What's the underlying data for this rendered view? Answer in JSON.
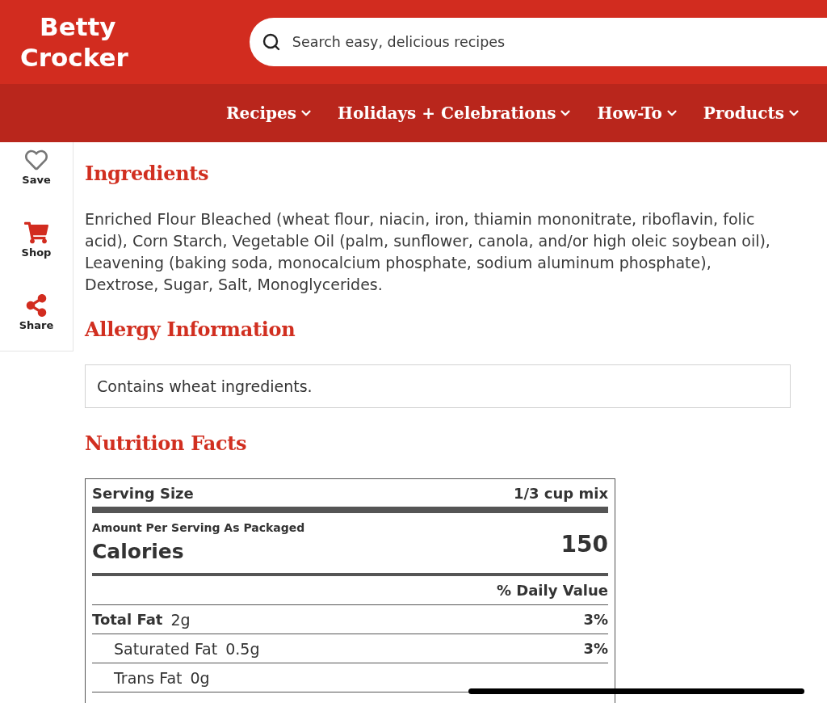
{
  "header": {
    "logo": {
      "line_1": "Betty",
      "line_2": "Crocker"
    },
    "search": {
      "placeholder": "Search easy, delicious recipes"
    }
  },
  "nav": {
    "items": [
      {
        "label": "Recipes"
      },
      {
        "label": "Holidays + Celebrations"
      },
      {
        "label": "How-To"
      },
      {
        "label": "Products"
      }
    ]
  },
  "sidebar": {
    "actions": [
      {
        "kind": "heart",
        "label": "Save"
      },
      {
        "kind": "cart",
        "label": "Shop"
      },
      {
        "kind": "share",
        "label": "Share"
      }
    ]
  },
  "sections": [
    {
      "kind": "paragraph",
      "title": "Ingredients",
      "body": "Enriched Flour Bleached (wheat flour, niacin, iron, thiamin mononitrate, riboflavin, folic acid), Corn Starch, Vegetable Oil (palm, sunflower, canola, and/or high oleic soybean oil), Leavening (baking soda, monocalcium phosphate, sodium aluminum phosphate), Dextrose, Sugar, Salt, Monoglycerides."
    },
    {
      "kind": "notice",
      "title": "Allergy Information",
      "body": "Contains wheat ingredients."
    },
    {
      "kind": "nutrition",
      "title": "Nutrition Facts",
      "facts": {
        "serving_size_label": "Serving Size",
        "serving_size": "1/3 cup mix",
        "amount_note": "Amount Per Serving As Packaged",
        "calories_label": "Calories",
        "calories": "150",
        "daily_value_heading": "% Daily Value",
        "rows": [
          {
            "kind": "main",
            "name": "Total Fat",
            "amount": "2g",
            "daily_value": "3%"
          },
          {
            "kind": "sub",
            "name": "Saturated Fat",
            "amount": "0.5g",
            "daily_value": "3%"
          },
          {
            "kind": "sub",
            "name": "Trans Fat",
            "amount": "0g"
          }
        ]
      }
    }
  ]
}
